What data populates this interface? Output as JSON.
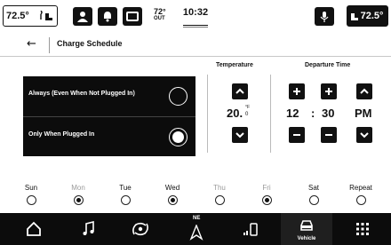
{
  "status_bar": {
    "left_temp": "72.5°",
    "outside_temp": "72°",
    "outside_label": "OUT",
    "time": "10:32",
    "right_temp": "72.5°"
  },
  "header": {
    "back_label": "←",
    "title": "Charge Schedule"
  },
  "options": [
    {
      "label": "Always (Even When Not Plugged In)",
      "selected": false
    },
    {
      "label": "Only When Plugged In",
      "selected": true
    }
  ],
  "temperature": {
    "title": "Temperature",
    "value": "20.",
    "decimal": "0",
    "unit": "°F"
  },
  "departure": {
    "title": "Departure Time",
    "hour": "12",
    "separator": ":",
    "minute": "30",
    "period": "PM"
  },
  "days": [
    {
      "label": "Sun",
      "selected": false,
      "muted": false
    },
    {
      "label": "Mon",
      "selected": true,
      "muted": true
    },
    {
      "label": "Tue",
      "selected": false,
      "muted": false
    },
    {
      "label": "Wed",
      "selected": true,
      "muted": false
    },
    {
      "label": "Thu",
      "selected": false,
      "muted": true
    },
    {
      "label": "Fri",
      "selected": true,
      "muted": true
    },
    {
      "label": "Sat",
      "selected": false,
      "muted": false
    },
    {
      "label": "Repeat",
      "selected": false,
      "muted": false
    }
  ],
  "nav": {
    "compass_label": "NE",
    "vehicle_label": "Vehicle"
  },
  "icons": {
    "status": [
      "seat-heat-icon",
      "person-icon",
      "bell-icon",
      "screen-off-icon",
      "microphone-icon",
      "seat-heat-right-icon"
    ],
    "nav": [
      "home-icon",
      "music-icon",
      "climate-fan-icon",
      "compass-icon",
      "phone-signal-icon",
      "car-icon",
      "apps-grid-icon"
    ]
  }
}
